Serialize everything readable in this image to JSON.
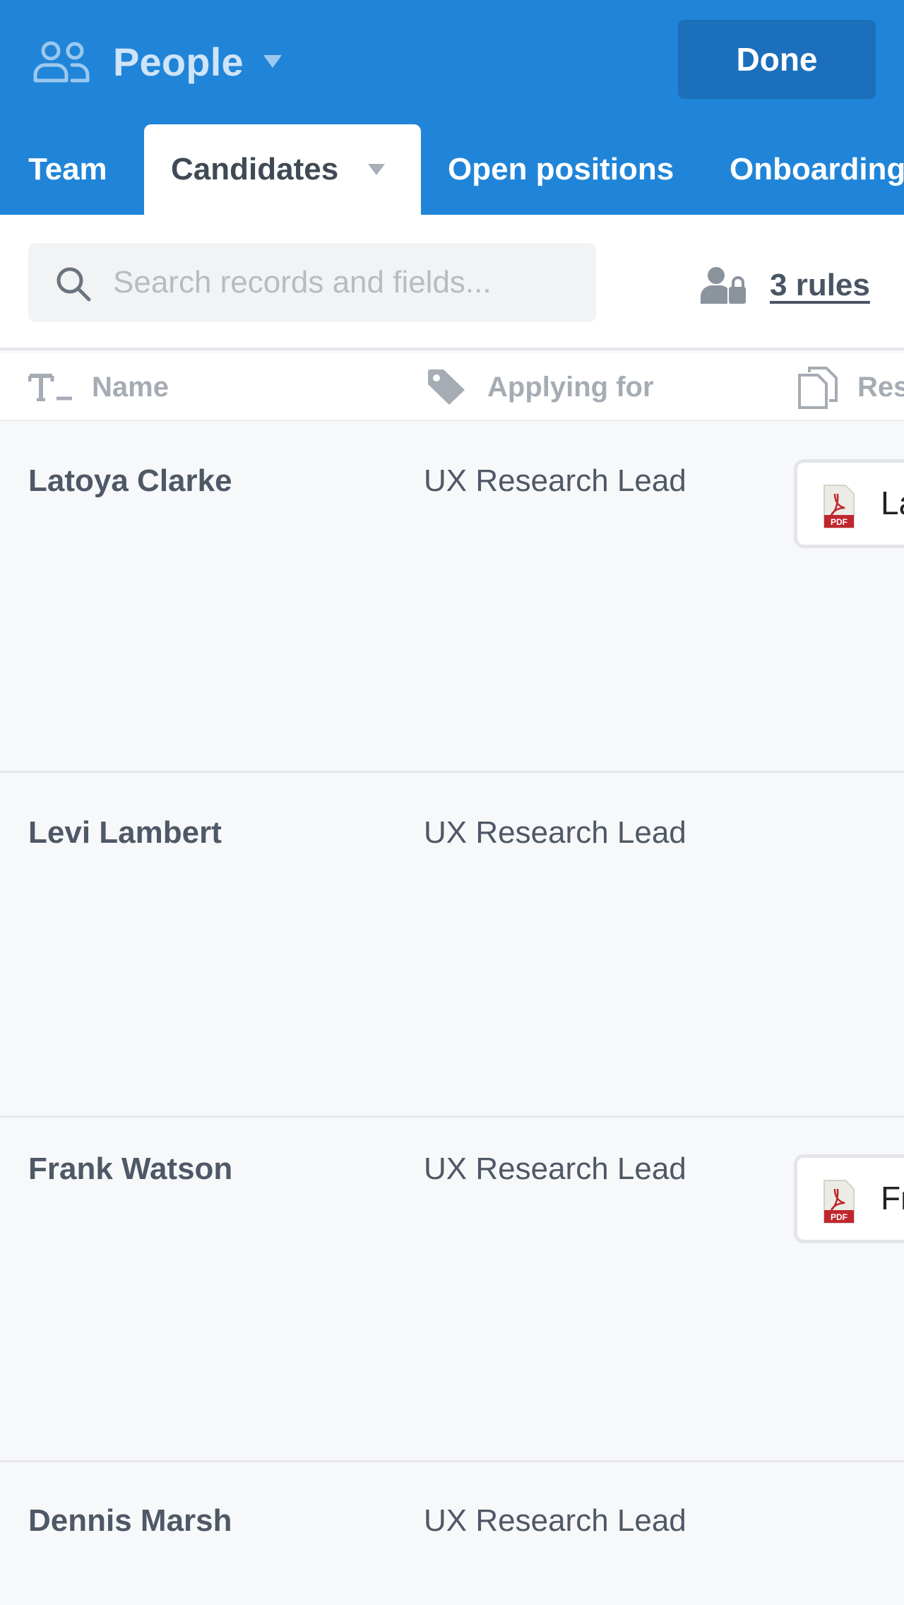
{
  "header": {
    "base_name": "People",
    "done_label": "Done",
    "colors": {
      "header_bg": "#2085d8",
      "done_bg": "#1c6fba"
    }
  },
  "tabs": [
    {
      "label": "Team",
      "active": false
    },
    {
      "label": "Candidates",
      "active": true
    },
    {
      "label": "Open positions",
      "active": false
    },
    {
      "label": "Onboarding",
      "active": false
    }
  ],
  "toolbar": {
    "search_placeholder": "Search records and fields...",
    "search_value": "",
    "rules_label": "3 rules"
  },
  "columns": [
    {
      "label": "Name",
      "icon": "text-field-icon"
    },
    {
      "label": "Applying for",
      "icon": "tag-icon"
    },
    {
      "label": "Resume",
      "icon": "attachment-icon"
    }
  ],
  "rows": [
    {
      "name": "Latoya Clarke",
      "applying_for": "UX Research Lead",
      "attachment": "La"
    },
    {
      "name": "Levi Lambert",
      "applying_for": "UX Research Lead",
      "attachment": ""
    },
    {
      "name": "Frank Watson",
      "applying_for": "UX Research Lead",
      "attachment": "Fr"
    },
    {
      "name": "Dennis Marsh",
      "applying_for": "UX Research Lead",
      "attachment": ""
    }
  ]
}
